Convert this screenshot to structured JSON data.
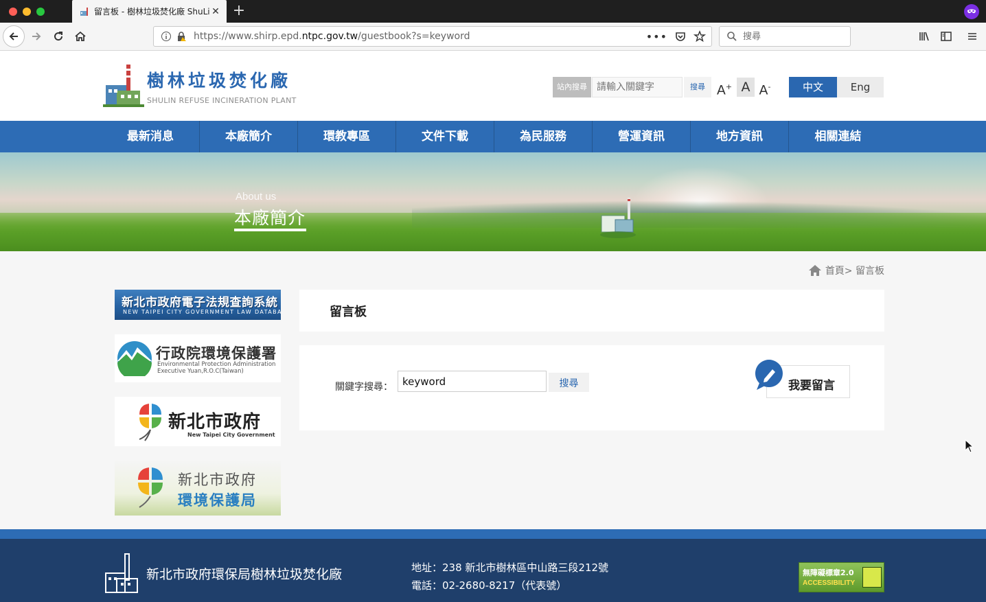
{
  "browser": {
    "tab_title": "留言板 - 樹林垃圾焚化廠 ShuLin",
    "url_prefix": "https://www.shirp.epd.",
    "url_domain": "ntpc.gov.tw",
    "url_path": "/guestbook?s=keyword",
    "search_placeholder": "搜尋",
    "colors": {
      "titlebar": "#1f1f1f",
      "toolbar": "#f5f5f5"
    }
  },
  "site": {
    "logo_name": "樹林垃圾焚化廠",
    "logo_en": "SHULIN REFUSE INCINERATION PLANT",
    "search_label": "站內搜尋",
    "search_placeholder": "請輸入關鍵字",
    "search_button": "搜尋",
    "font_big": "A",
    "font_mid": "A",
    "font_small": "A",
    "lang_zh": "中文",
    "lang_en": "Eng",
    "accent_color": "#2d6cb5"
  },
  "nav": {
    "items": [
      {
        "label": "最新消息"
      },
      {
        "label": "本廠簡介"
      },
      {
        "label": "環教專區"
      },
      {
        "label": "文件下載"
      },
      {
        "label": "為民服務"
      },
      {
        "label": "營運資訊"
      },
      {
        "label": "地方資訊"
      },
      {
        "label": "相關連結"
      }
    ]
  },
  "banner": {
    "subtitle": "About us",
    "title": "本廠簡介"
  },
  "breadcrumb": {
    "text": "首頁> 留言板"
  },
  "sidebar": {
    "law": {
      "title": "新北市政府電子法規查詢系統",
      "en": "NEW TAIPEI CITY GOVERNMENT LAW DATABASE"
    },
    "epa": {
      "title": "行政院環境保護署",
      "en1": "Environmental Protection Administration",
      "en2": "Executive Yuan,R.O.C(Taiwan)"
    },
    "ntpc": {
      "title": "新北市政府",
      "en": "New Taipei City Government"
    },
    "epd": {
      "line1": "新北市政府",
      "line2": "環境保護局"
    }
  },
  "guestbook": {
    "title": "留言板",
    "keyword_label": "關鍵字搜尋：",
    "keyword_value": "keyword",
    "search_button": "搜尋",
    "post_button": "我要留言"
  },
  "footer": {
    "name": "新北市政府環保局樹林垃圾焚化廠",
    "address": "地址：238 新北市樹林區中山路三段212號",
    "phone": "電話：02-2680-8217（代表號）",
    "badge_line1": "無障礙標章2.0",
    "badge_line2": "ACCESSIBILITY"
  }
}
